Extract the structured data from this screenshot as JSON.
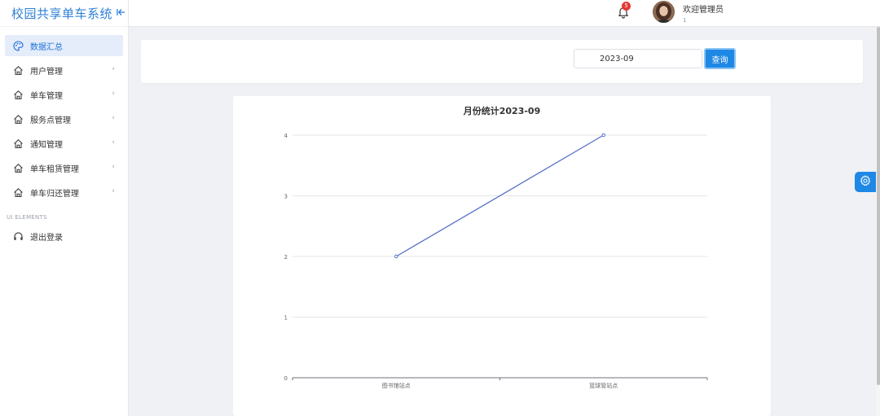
{
  "app": {
    "title": "校园共享单车系统",
    "collapse_icon": "collapse-left-icon"
  },
  "sidebar": {
    "items": [
      {
        "label": "数据汇总",
        "icon": "palette-icon",
        "active": true
      },
      {
        "label": "用户管理",
        "icon": "home-icon"
      },
      {
        "label": "单车管理",
        "icon": "home-icon"
      },
      {
        "label": "服务点管理",
        "icon": "home-icon"
      },
      {
        "label": "通知管理",
        "icon": "home-icon"
      },
      {
        "label": "单车租赁管理",
        "icon": "home-icon"
      },
      {
        "label": "单车归还管理",
        "icon": "home-icon"
      }
    ],
    "section_label": "UI ELEMENTS",
    "logout_label": "退出登录",
    "logout_icon": "headset-icon"
  },
  "header": {
    "notification_count": "5",
    "user_name": "欢迎管理员",
    "user_sub": "1"
  },
  "filter": {
    "date_value": "2023-09",
    "query_label": "查询"
  },
  "colors": {
    "accent": "#1e88e5",
    "brand": "#2f80d6",
    "line": "#5470c6",
    "badge": "#e53935"
  },
  "chart_data": {
    "type": "line",
    "title": "月份统计2023-09",
    "categories": [
      "图书馆站点",
      "篮球管站点"
    ],
    "series": [
      {
        "values": [
          2,
          4
        ]
      }
    ],
    "ylim": [
      0,
      4
    ],
    "yticks": [
      0,
      1,
      2,
      3,
      4
    ],
    "grid": true,
    "xlabel": "",
    "ylabel": ""
  }
}
